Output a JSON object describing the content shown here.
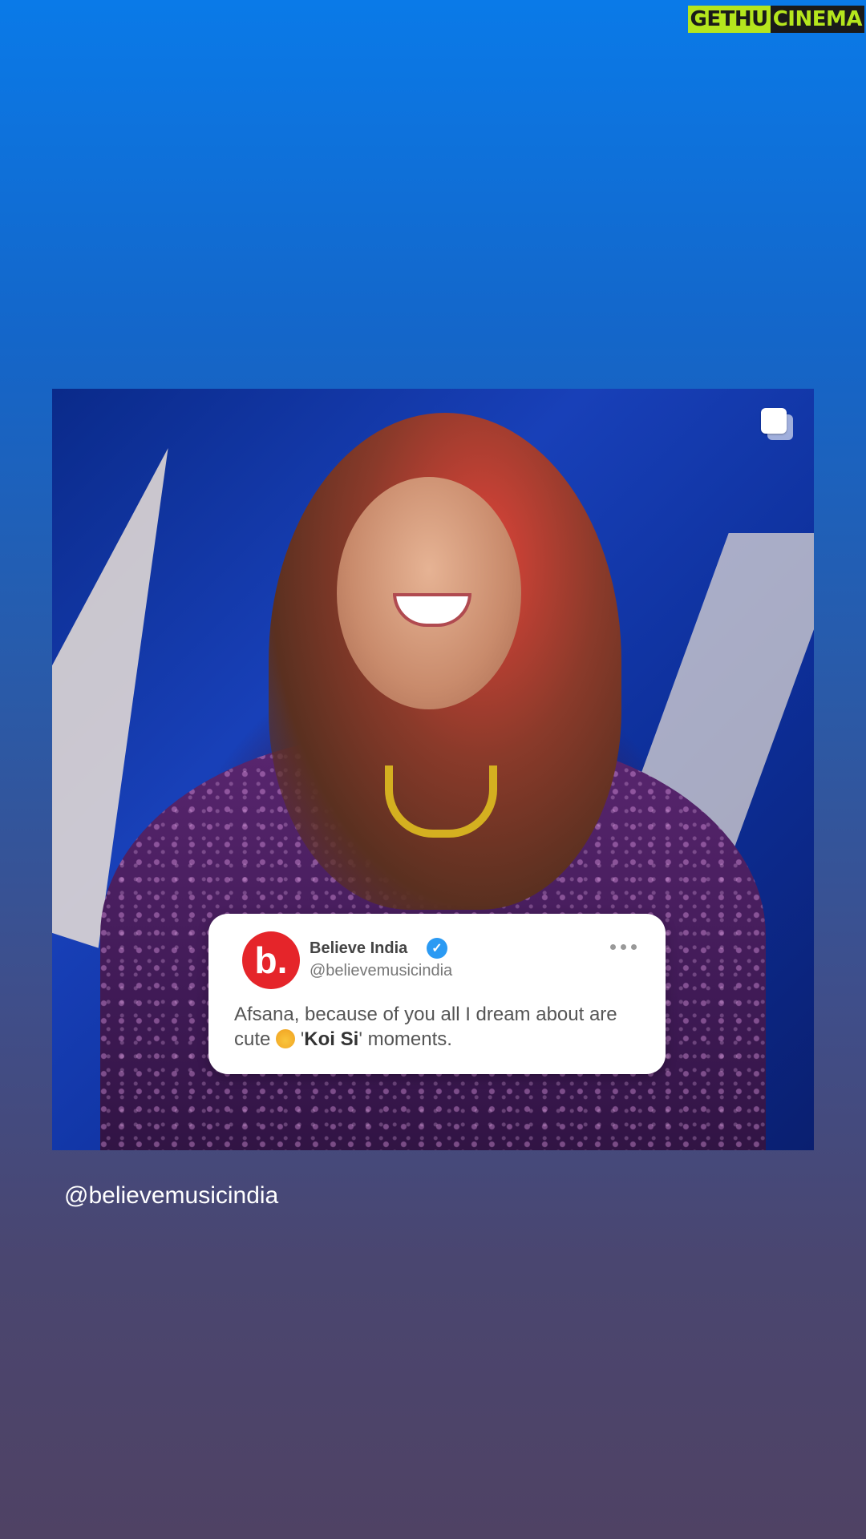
{
  "watermark": {
    "part1": "GETHU",
    "part2": "CINEMA"
  },
  "post": {
    "tweet": {
      "avatar_letter": "b.",
      "name": "Believe India",
      "handle": "@believemusicindia",
      "text_before": "Afsana, because of you all I dream about are cute",
      "text_quote_open": " '",
      "text_bold": "Koi Si",
      "text_quote_close": "'",
      "text_after": " moments."
    },
    "icons": {
      "multi": "carousel-multiple-icon",
      "verified": "verified-badge-icon",
      "more": "more-options-icon"
    }
  },
  "caption": "@believemusicindia",
  "colors": {
    "avatar_red": "#e5252a",
    "verified_blue": "#2b9af3",
    "watermark_green": "#b5e61d"
  }
}
